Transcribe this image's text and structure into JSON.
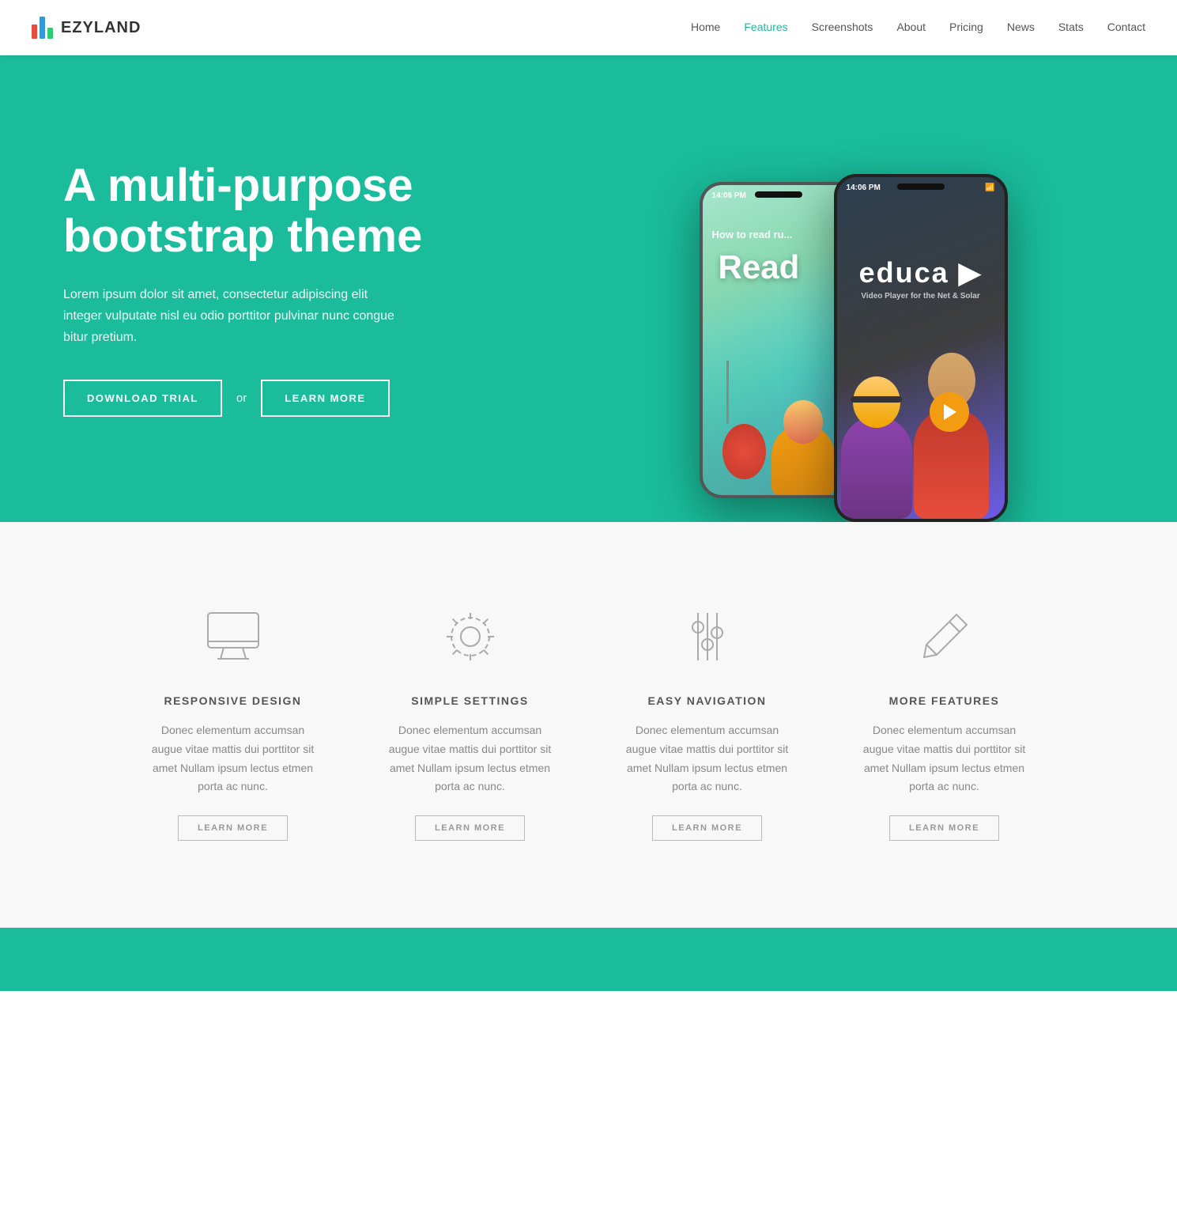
{
  "navbar": {
    "logo_text": "EZYLAND",
    "links": [
      {
        "label": "Home",
        "active": false
      },
      {
        "label": "Features",
        "active": true
      },
      {
        "label": "Screenshots",
        "active": false
      },
      {
        "label": "About",
        "active": false
      },
      {
        "label": "Pricing",
        "active": false
      },
      {
        "label": "News",
        "active": false
      },
      {
        "label": "Stats",
        "active": false
      },
      {
        "label": "Contact",
        "active": false
      }
    ]
  },
  "hero": {
    "title": "A multi-purpose bootstrap theme",
    "description": "Lorem ipsum dolor sit amet, consectetur adipiscing elit integer vulputate nisl eu odio porttitor pulvinar nunc congue bitur pretium.",
    "download_label": "DOWNLOAD TRIAL",
    "or_label": "or",
    "learn_more_label": "LEARN MORE"
  },
  "features": [
    {
      "icon": "monitor",
      "title": "RESPONSIVE DESIGN",
      "description": "Donec elementum accumsan augue vitae mattis dui porttitor sit amet Nullam ipsum lectus etmen porta ac nunc.",
      "learn_more": "LEARN MORE"
    },
    {
      "icon": "settings",
      "title": "SIMPLE SETTINGS",
      "description": "Donec elementum accumsan augue vitae mattis dui porttitor sit amet Nullam ipsum lectus etmen porta ac nunc.",
      "learn_more": "LEARN MORE"
    },
    {
      "icon": "sliders",
      "title": "EASY NAVIGATION",
      "description": "Donec elementum accumsan augue vitae mattis dui porttitor sit amet Nullam ipsum lectus etmen porta ac nunc.",
      "learn_more": "LEARN MORE"
    },
    {
      "icon": "pencil",
      "title": "MORE FEATURES",
      "description": "Donec elementum accumsan augue vitae mattis dui porttitor sit amet Nullam ipsum lectus etmen porta ac nunc.",
      "learn_more": "LEARN MORE"
    }
  ]
}
